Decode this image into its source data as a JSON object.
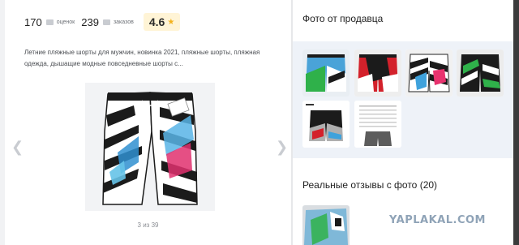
{
  "stats": {
    "reviews_count": "170",
    "reviews_label": "оценок",
    "orders_count": "239",
    "orders_label": "заказов",
    "rating": "4.6"
  },
  "description": "Летние пляжные шорты для мужчин, новинка 2021, пляжные шорты, пляжная одежда, дышащие модные повседневные шорты с...",
  "gallery": {
    "counter": "3 из 39"
  },
  "seller_photos": {
    "title": "Фото от продавца"
  },
  "reviews_photos": {
    "title": "Реальные отзывы с фото (20)"
  },
  "watermark": "YAPLAKAL.COM",
  "colors": {
    "rating_bg": "#fff4d6",
    "star": "#f4b21d",
    "thumbs_bg": "#eef2f8"
  }
}
